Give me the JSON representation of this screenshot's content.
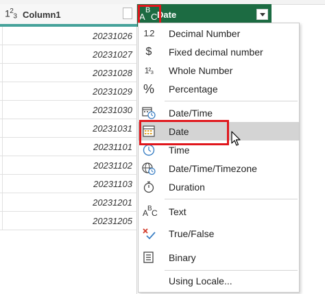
{
  "columns": [
    {
      "name": "Column1",
      "type_icon": "whole-number-icon"
    },
    {
      "name": "Date",
      "type_icon": "text-abc-icon"
    }
  ],
  "type_labels": {
    "col1_icon_text": "1",
    "col1_icon_sub": "2",
    "col1_icon_sub2": "3",
    "col2_icon_a": "A",
    "col2_icon_b": "B",
    "col2_icon_c": "C"
  },
  "rows": [
    "20231026",
    "20231027",
    "20231028",
    "20231029",
    "20231030",
    "20231031",
    "20231101",
    "20231102",
    "20231103",
    "20231201",
    "20231205"
  ],
  "menu": {
    "items": [
      {
        "label": "Decimal Number",
        "icon": "decimal-number-icon",
        "glyph": "1.2"
      },
      {
        "label": "Fixed decimal number",
        "icon": "currency-icon",
        "glyph": "$"
      },
      {
        "label": "Whole Number",
        "icon": "whole-number-icon",
        "glyph": "1²₃"
      },
      {
        "label": "Percentage",
        "icon": "percent-icon",
        "glyph": "%"
      },
      {
        "label": "Date/Time",
        "icon": "datetime-icon",
        "glyph": ""
      },
      {
        "label": "Date",
        "icon": "calendar-icon",
        "glyph": ""
      },
      {
        "label": "Time",
        "icon": "clock-icon",
        "glyph": ""
      },
      {
        "label": "Date/Time/Timezone",
        "icon": "globe-clock-icon",
        "glyph": ""
      },
      {
        "label": "Duration",
        "icon": "stopwatch-icon",
        "glyph": ""
      },
      {
        "label": "Text",
        "icon": "text-abc-icon",
        "glyph": ""
      },
      {
        "label": "True/False",
        "icon": "true-false-icon",
        "glyph": ""
      },
      {
        "label": "Binary",
        "icon": "binary-icon",
        "glyph": ""
      },
      {
        "label": "Using Locale...",
        "icon": "",
        "glyph": ""
      }
    ],
    "hovered": "Date"
  },
  "colors": {
    "header_selected": "#1c6b42",
    "accent_teal": "#45a29a",
    "highlight_red": "#e0161c",
    "hover_gray": "#d4d4d4"
  }
}
